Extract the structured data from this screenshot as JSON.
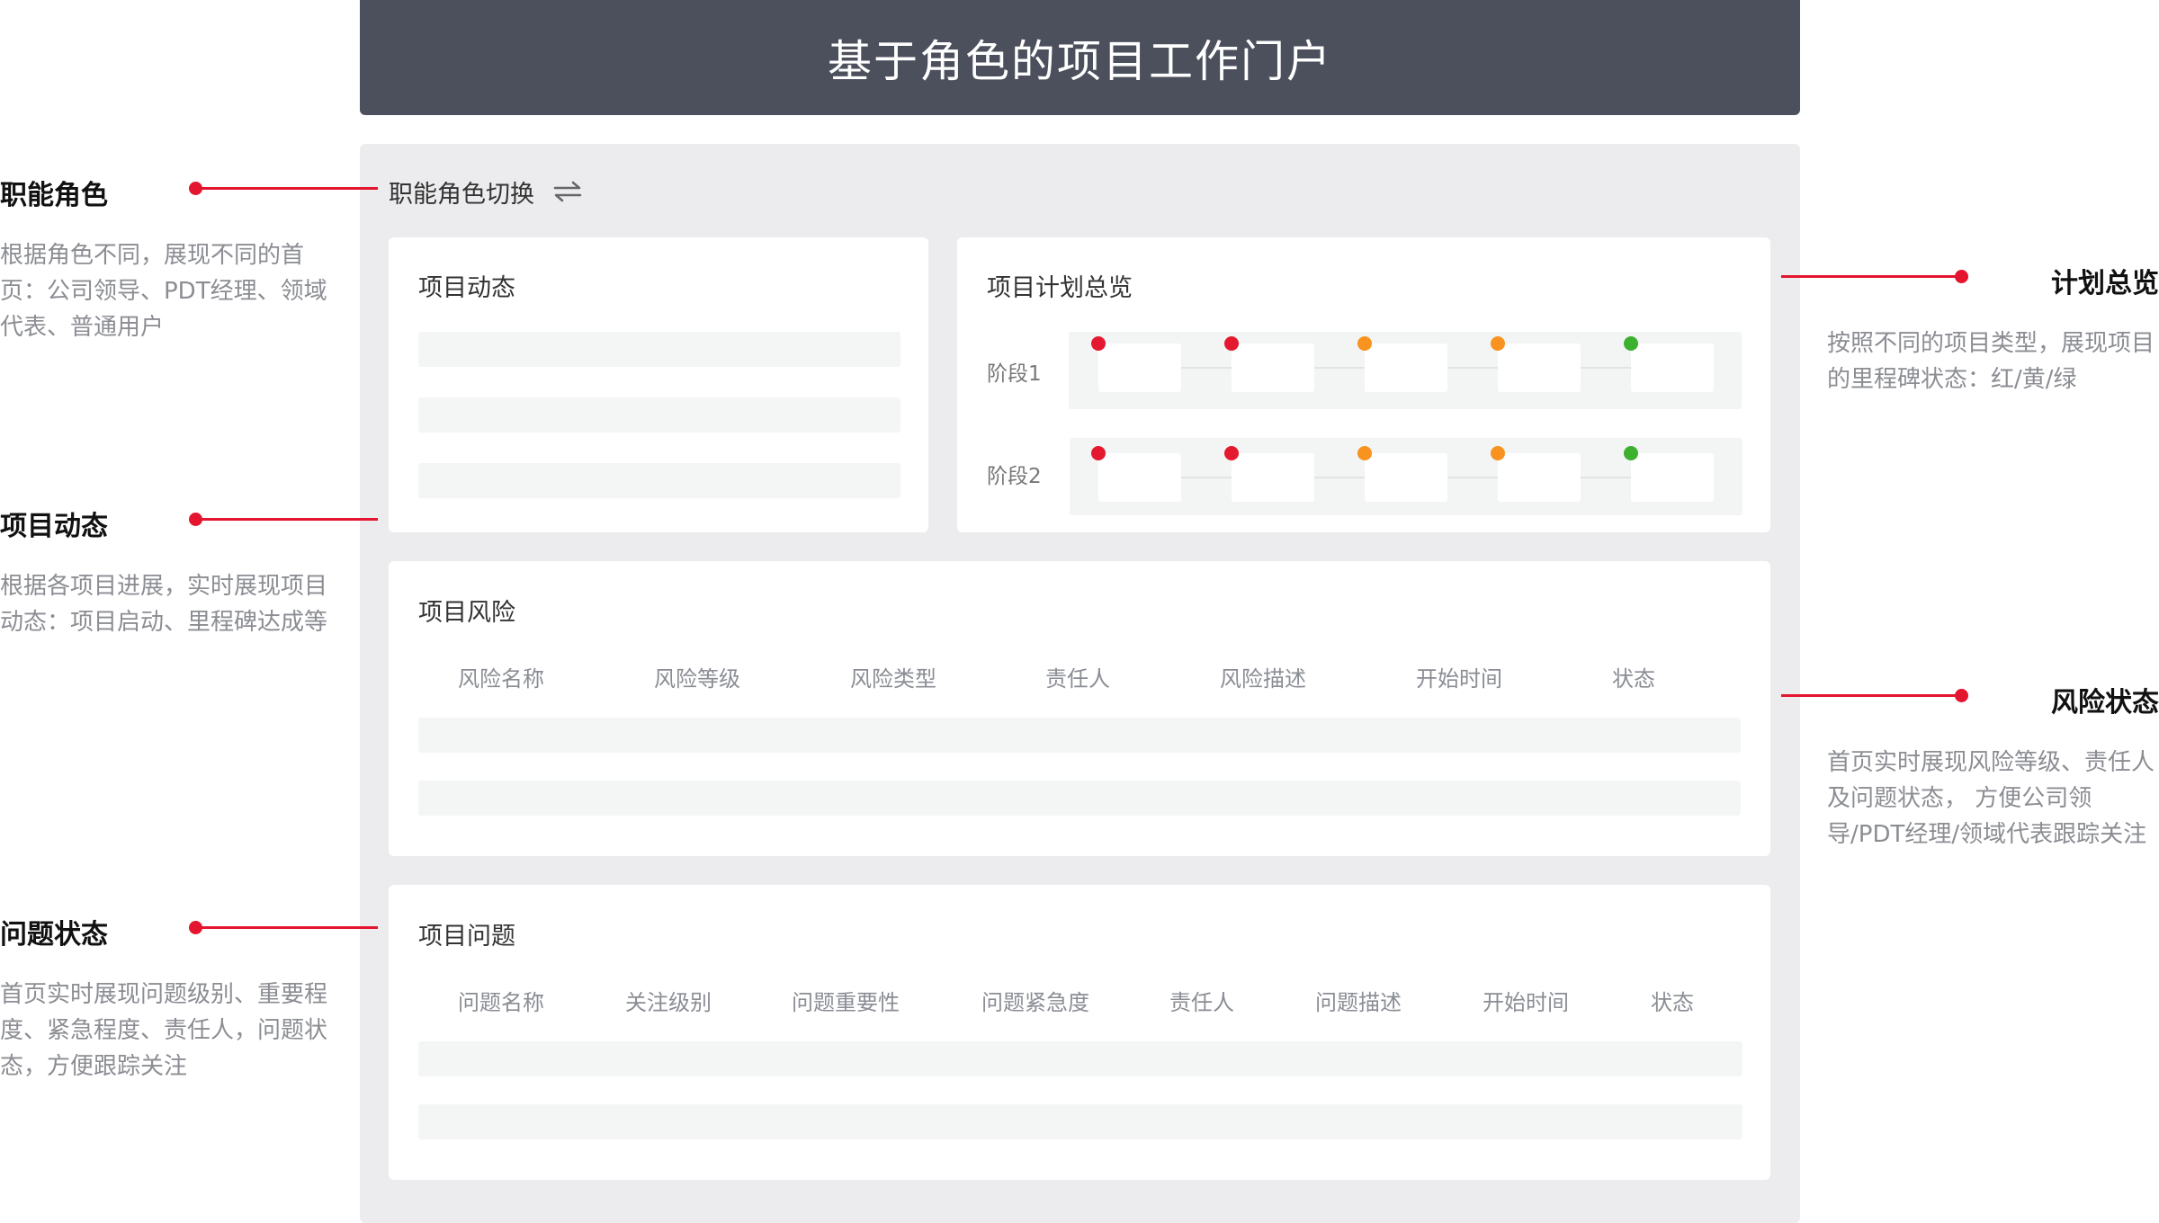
{
  "header": {
    "title": "基于角色的项目工作门户"
  },
  "role_switch": {
    "label": "职能角色切换",
    "icon": "swap-arrows-icon"
  },
  "cards": {
    "dynamics": {
      "title": "项目动态"
    },
    "plan": {
      "title": "项目计划总览",
      "stages": [
        {
          "label": "阶段1",
          "milestones": [
            "red",
            "red",
            "yellow",
            "yellow",
            "green"
          ]
        },
        {
          "label": "阶段2",
          "milestones": [
            "red",
            "red",
            "yellow",
            "yellow",
            "green"
          ]
        }
      ]
    },
    "risk": {
      "title": "项目风险",
      "columns": [
        "风险名称",
        "风险等级",
        "风险类型",
        "责任人",
        "风险描述",
        "开始时间",
        "状态"
      ]
    },
    "issue": {
      "title": "项目问题",
      "columns": [
        "问题名称",
        "关注级别",
        "问题重要性",
        "问题紧急度",
        "责任人",
        "问题描述",
        "开始时间",
        "状态"
      ]
    }
  },
  "annotations": {
    "role": {
      "title": "职能角色",
      "desc": "根据角色不同，展现不同的首页：公司领导、PDT经理、领域代表、普通用户"
    },
    "dynamics": {
      "title": "项目动态",
      "desc": "根据各项目进展，实时展现项目动态：项目启动、里程碑达成等"
    },
    "issue": {
      "title": "问题状态",
      "desc": "首页实时展现问题级别、重要程度、紧急程度、责任人，问题状态，方便跟踪关注"
    },
    "plan": {
      "title": "计划总览",
      "desc": "按照不同的项目类型，展现项目的里程碑状态：红/黄/绿"
    },
    "risk": {
      "title": "风险状态",
      "desc": "首页实时展现风险等级、责任人及问题状态， 方便公司领导/PDT经理/领域代表跟踪关注"
    }
  },
  "colors": {
    "header_bg": "#4b505c",
    "accent": "#e3152f",
    "status_red": "#e4192f",
    "status_yellow": "#f7931e",
    "status_green": "#3cb02f"
  }
}
